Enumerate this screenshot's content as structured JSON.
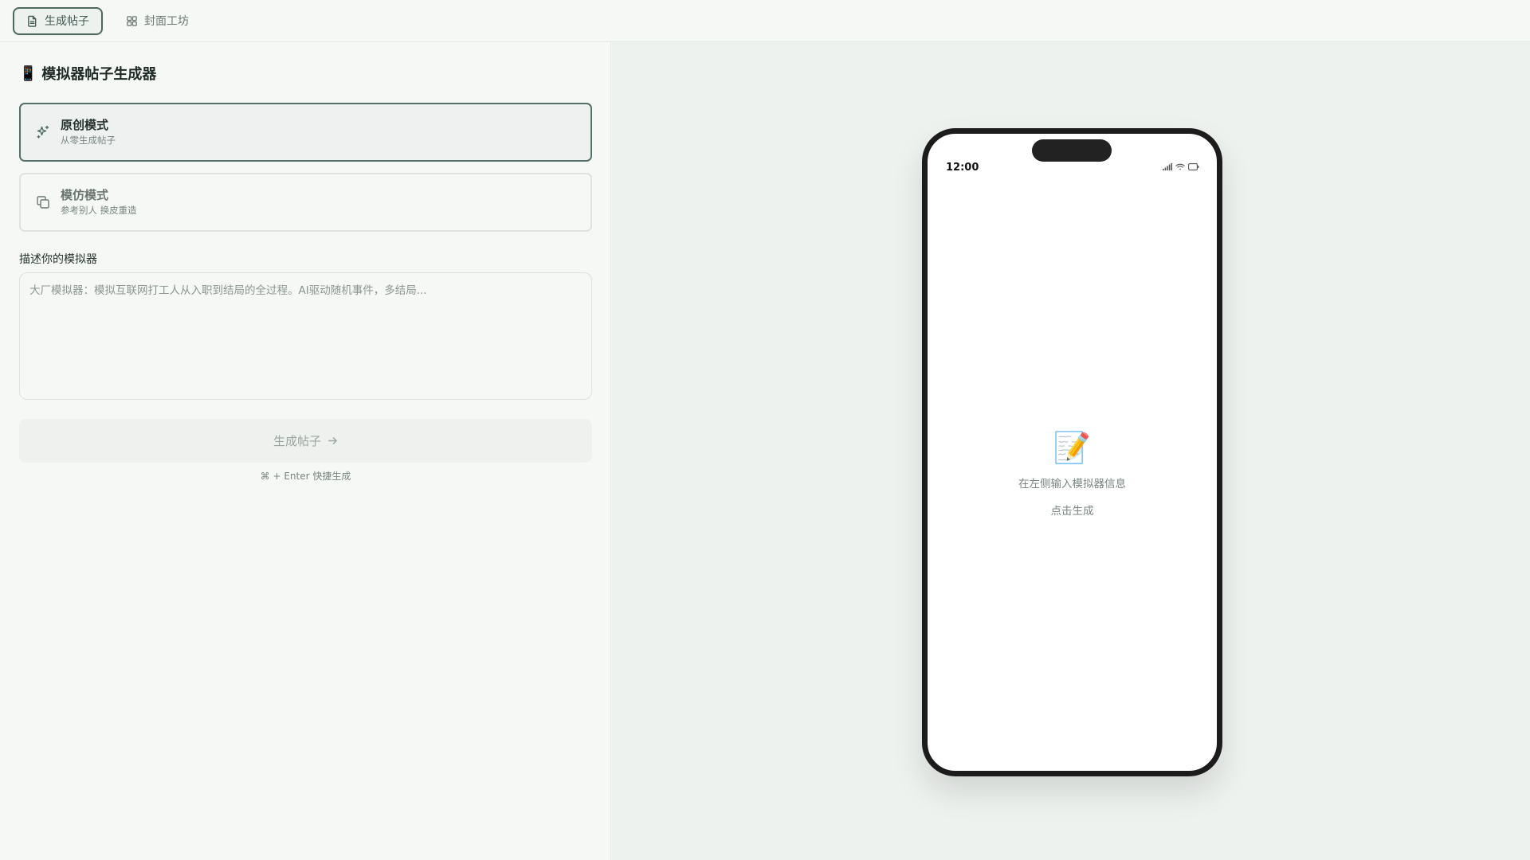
{
  "nav": {
    "tabs": [
      {
        "label": "生成帖子",
        "icon": "document-icon",
        "active": true
      },
      {
        "label": "封面工坊",
        "icon": "grid-icon",
        "active": false
      }
    ]
  },
  "left": {
    "title_emoji": "📱",
    "title": "模拟器帖子生成器",
    "modes": [
      {
        "title": "原创模式",
        "subtitle": "从零生成帖子",
        "icon": "sparkles-icon",
        "selected": true
      },
      {
        "title": "模仿模式",
        "subtitle": "参考别人 换皮重造",
        "icon": "copy-icon",
        "selected": false
      }
    ],
    "field_label": "描述你的模拟器",
    "textarea_value": "",
    "textarea_placeholder": "大厂模拟器：模拟互联网打工人从入职到结局的全过程。AI驱动随机事件，多结局...",
    "generate_label": "生成帖子",
    "generate_icon": "arrow-right-icon",
    "shortcut_hint": "⌘ + Enter 快捷生成"
  },
  "preview": {
    "status_time": "12:00",
    "status_icons": [
      "signal-icon",
      "wifi-icon",
      "battery-icon"
    ],
    "empty_emoji": "📝",
    "empty_line1": "在左侧输入模拟器信息",
    "empty_line2": "点击生成"
  },
  "colors": {
    "accent": "#4d6a5f",
    "background": "#f6f8f6",
    "preview_background": "#eef2ef",
    "phone_frame": "#1c1c1c"
  }
}
